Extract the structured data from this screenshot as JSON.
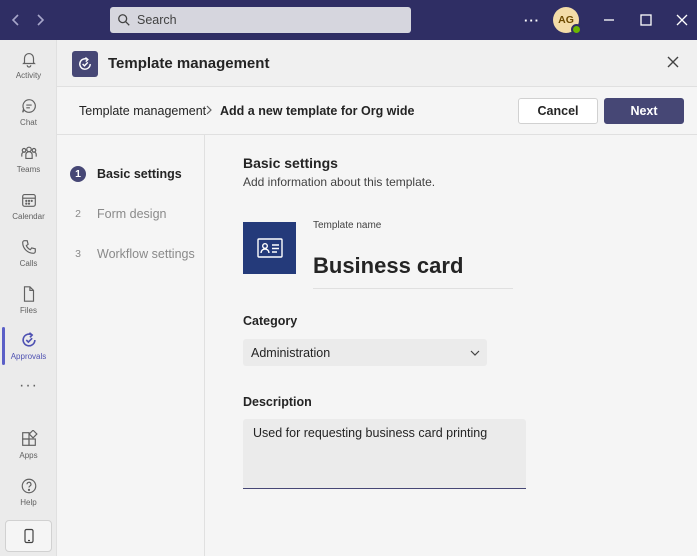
{
  "titlebar": {
    "search_placeholder": "Search",
    "more_label": "···",
    "avatar_initials": "AG",
    "presence_color": "#6bb700",
    "bg_color": "#2f2e64"
  },
  "rail": {
    "items": [
      {
        "label": "Activity",
        "icon": "bell-icon"
      },
      {
        "label": "Chat",
        "icon": "chat-icon"
      },
      {
        "label": "Teams",
        "icon": "teams-icon"
      },
      {
        "label": "Calendar",
        "icon": "calendar-icon"
      },
      {
        "label": "Calls",
        "icon": "phone-icon"
      },
      {
        "label": "Files",
        "icon": "file-icon"
      },
      {
        "label": "Approvals",
        "icon": "approvals-icon",
        "active": true
      },
      {
        "label": "Apps",
        "icon": "apps-icon"
      },
      {
        "label": "Help",
        "icon": "help-icon"
      }
    ],
    "more_label": "···"
  },
  "dialog": {
    "title": "Template management",
    "accent_color": "#464775"
  },
  "breadcrumb": {
    "parent": "Template management",
    "current": "Add a new template for Org wide"
  },
  "actions": {
    "cancel_label": "Cancel",
    "next_label": "Next"
  },
  "steps": [
    {
      "number": "1",
      "label": "Basic settings",
      "active": true
    },
    {
      "number": "2",
      "label": "Form design",
      "active": false
    },
    {
      "number": "3",
      "label": "Workflow settings",
      "active": false
    }
  ],
  "basic_settings": {
    "title": "Basic settings",
    "subtitle": "Add information about this template.",
    "template_name_label": "Template name",
    "template_name": "Business card",
    "category_label": "Category",
    "category_value": "Administration",
    "description_label": "Description",
    "description_value": "Used for requesting business card printing"
  }
}
